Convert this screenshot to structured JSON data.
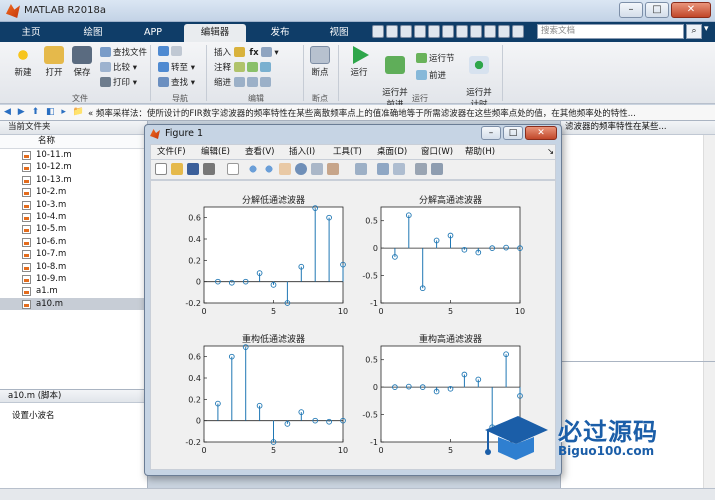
{
  "window": {
    "title": "MATLAB R2018a"
  },
  "tabs": [
    "主页",
    "绘图",
    "APP",
    "编辑器",
    "发布",
    "视图"
  ],
  "active_tab": "编辑器",
  "search": {
    "placeholder": "搜索文档"
  },
  "ribbon": {
    "file": {
      "new": "新建",
      "open": "打开",
      "save": "保存",
      "find_files": "查找文件",
      "compare": "比较",
      "print": "打印",
      "group": "文件"
    },
    "nav": {
      "goto": "转至",
      "find": "查找",
      "group": "导航"
    },
    "edit": {
      "insert": "插入",
      "comment": "注释",
      "indent": "缩进",
      "fx": "fx",
      "group": "编辑"
    },
    "breakpoints": {
      "label": "断点",
      "group": "断点"
    },
    "run": {
      "run": "运行",
      "run_advance": "运行并\n前进",
      "run_section": "运行节",
      "advance": "前进",
      "run_time": "运行并\n计时",
      "group": "运行"
    }
  },
  "address": {
    "text": "«  频率采样法：使所设计的FIR数字滤波器的频率特性在某些离散频率点上的值准确地等于所需滤波器在这些频率点处的值，在其他频率处的特性..."
  },
  "current_folder": {
    "header": "当前文件夹",
    "col_name": "名称",
    "files": [
      "10-11.m",
      "10-12.m",
      "10-13.m",
      "10-2.m",
      "10-3.m",
      "10-4.m",
      "10-5.m",
      "10-6.m",
      "10-7.m",
      "10-8.m",
      "10-9.m",
      "a1.m",
      "a10.m"
    ],
    "selected": "a10.m"
  },
  "details": {
    "header": "a10.m  (脚本)",
    "body": "设置小波名"
  },
  "right_panel": {
    "header": "滤波器的频率特性在某些..."
  },
  "figure": {
    "title": "Figure 1",
    "menu": [
      "文件(F)",
      "编辑(E)",
      "查看(V)",
      "插入(I)",
      "工具(T)",
      "桌面(D)",
      "窗口(W)",
      "帮助(H)"
    ]
  },
  "chart_data": [
    {
      "type": "stem",
      "title": "分解低通滤波器",
      "x": [
        1,
        2,
        3,
        4,
        5,
        6,
        7,
        8,
        9,
        10
      ],
      "values": [
        0.0,
        -0.01,
        0.0,
        0.08,
        -0.03,
        -0.2,
        0.14,
        0.69,
        0.6,
        0.16
      ],
      "xlim": [
        0,
        10
      ],
      "ylim": [
        -0.2,
        0.7
      ],
      "xticks": [
        "0",
        "5",
        "10"
      ],
      "yticks": [
        "-0.2",
        "0",
        "0.2",
        "0.4",
        "0.6"
      ],
      "color": "#1f77b4"
    },
    {
      "type": "stem",
      "title": "分解高通滤波器",
      "x": [
        1,
        2,
        3,
        4,
        5,
        6,
        7,
        8,
        9,
        10
      ],
      "values": [
        -0.16,
        0.6,
        -0.73,
        0.14,
        0.23,
        -0.03,
        -0.08,
        0.0,
        0.01,
        0.0
      ],
      "xlim": [
        0,
        10
      ],
      "ylim": [
        -1,
        0.75
      ],
      "xticks": [
        "0",
        "5",
        "10"
      ],
      "yticks": [
        "-1",
        "-0.5",
        "0",
        "0.5"
      ],
      "color": "#1f77b4"
    },
    {
      "type": "stem",
      "title": "重构低通滤波器",
      "x": [
        1,
        2,
        3,
        4,
        5,
        6,
        7,
        8,
        9,
        10
      ],
      "values": [
        0.16,
        0.6,
        0.69,
        0.14,
        -0.2,
        -0.03,
        0.08,
        0.0,
        -0.01,
        0.0
      ],
      "xlim": [
        0,
        10
      ],
      "ylim": [
        -0.2,
        0.7
      ],
      "xticks": [
        "0",
        "5",
        "10"
      ],
      "yticks": [
        "-0.2",
        "0",
        "0.2",
        "0.4",
        "0.6"
      ],
      "color": "#1f77b4"
    },
    {
      "type": "stem",
      "title": "重构高通滤波器",
      "x": [
        1,
        2,
        3,
        4,
        5,
        6,
        7,
        8,
        9,
        10
      ],
      "values": [
        0.0,
        0.01,
        0.0,
        -0.08,
        -0.03,
        0.23,
        0.14,
        -0.73,
        0.6,
        -0.16
      ],
      "xlim": [
        0,
        10
      ],
      "ylim": [
        -1,
        0.75
      ],
      "xticks": [
        "0",
        "5",
        "10"
      ],
      "yticks": [
        "-1",
        "-0.5",
        "0",
        "0.5"
      ],
      "color": "#1f77b4"
    }
  ],
  "watermark": {
    "text": "必过源码",
    "url": "Biguo100.com"
  }
}
